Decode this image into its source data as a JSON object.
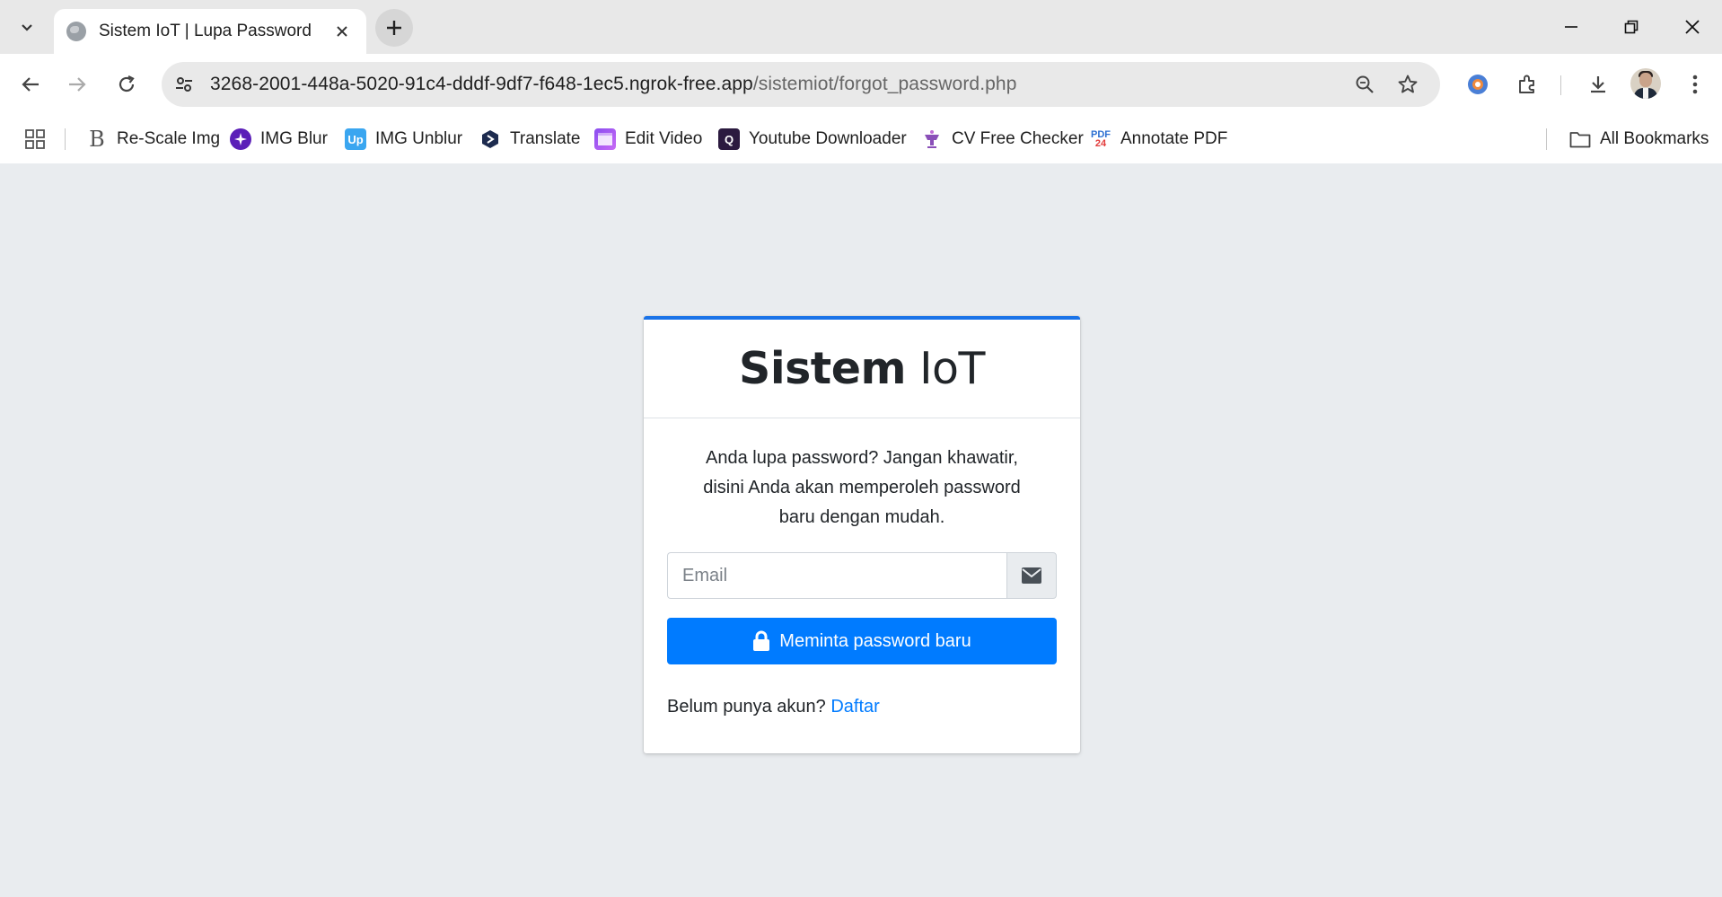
{
  "browser": {
    "tab_title": "Sistem IoT | Lupa Password",
    "url_host": "3268-2001-448a-5020-91c4-dddf-9df7-f648-1ec5.ngrok-free.app",
    "url_path": "/sistemiot/forgot_password.php",
    "bookmarks": [
      {
        "label": "Re-Scale Img",
        "icon": "rescale-icon"
      },
      {
        "label": "IMG Blur",
        "icon": "img-blur-icon"
      },
      {
        "label": "IMG Unblur",
        "icon": "img-unblur-icon"
      },
      {
        "label": "Translate",
        "icon": "translate-icon"
      },
      {
        "label": "Edit Video",
        "icon": "edit-video-icon"
      },
      {
        "label": "Youtube Downloader",
        "icon": "youtube-downloader-icon"
      },
      {
        "label": "CV Free Checker",
        "icon": "cv-checker-icon"
      },
      {
        "label": "Annotate PDF",
        "icon": "annotate-pdf-icon"
      }
    ],
    "all_bookmarks_label": "All Bookmarks"
  },
  "page": {
    "brand_bold": "Sistem",
    "brand_light": "IoT",
    "message": "Anda lupa password?  Jangan khawatir, disini Anda akan memperoleh password baru dengan mudah.",
    "email_placeholder": "Email",
    "submit_label": "Meminta password baru",
    "register_prompt": "Belum punya akun?",
    "register_link": "Daftar"
  },
  "colors": {
    "accent": "#007bff",
    "card_top_border": "#1a73e8",
    "page_background": "#e9ecef"
  }
}
